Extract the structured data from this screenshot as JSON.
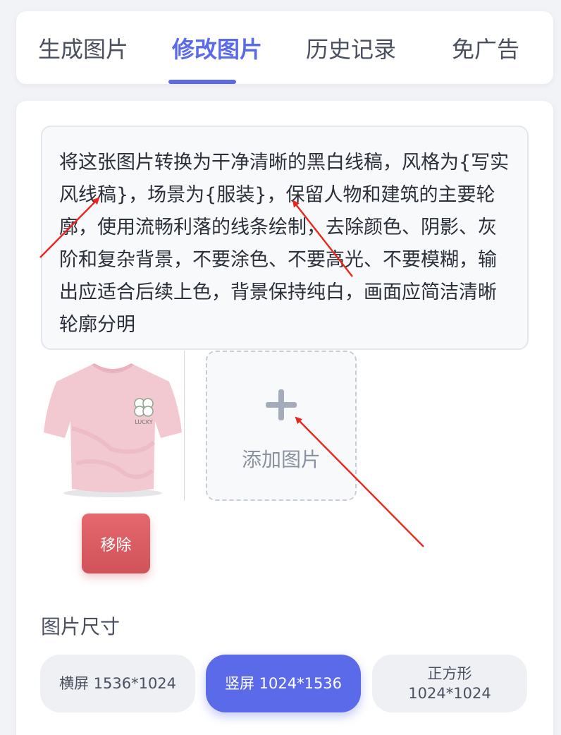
{
  "tabs": [
    {
      "label": "生成图片",
      "active": false
    },
    {
      "label": "修改图片",
      "active": true
    },
    {
      "label": "历史记录",
      "active": false
    },
    {
      "label": "免广告",
      "active": false
    }
  ],
  "prompt": {
    "text": "将这张图片转换为干净清晰的黑白线稿，风格为{写实风线稿}，场景为{服装}，保留人物和建筑的主要轮廓，使用流畅利落的线条绘制，去除颜色、阴影、灰阶和复杂背景，不要涂色、不要高光、不要模糊，输出应适合后续上色，背景保持纯白，画面应简洁清晰轮廓分明"
  },
  "upload": {
    "thumbnail_icon": "pink-tshirt-image",
    "shirt_print_text": "LUCKY",
    "remove_label": "移除",
    "add_label": "添加图片",
    "add_icon": "plus-icon"
  },
  "size": {
    "title": "图片尺寸",
    "options": [
      {
        "label": "横屏 1536*1024",
        "selected": false
      },
      {
        "label": "竖屏 1024*1536",
        "selected": true
      },
      {
        "line1": "正方形",
        "line2": "1024*1024",
        "selected": false
      }
    ]
  },
  "colors": {
    "accent": "#5b6ae8",
    "remove": "#d9585f",
    "annotation_arrow": "#e8271f"
  }
}
